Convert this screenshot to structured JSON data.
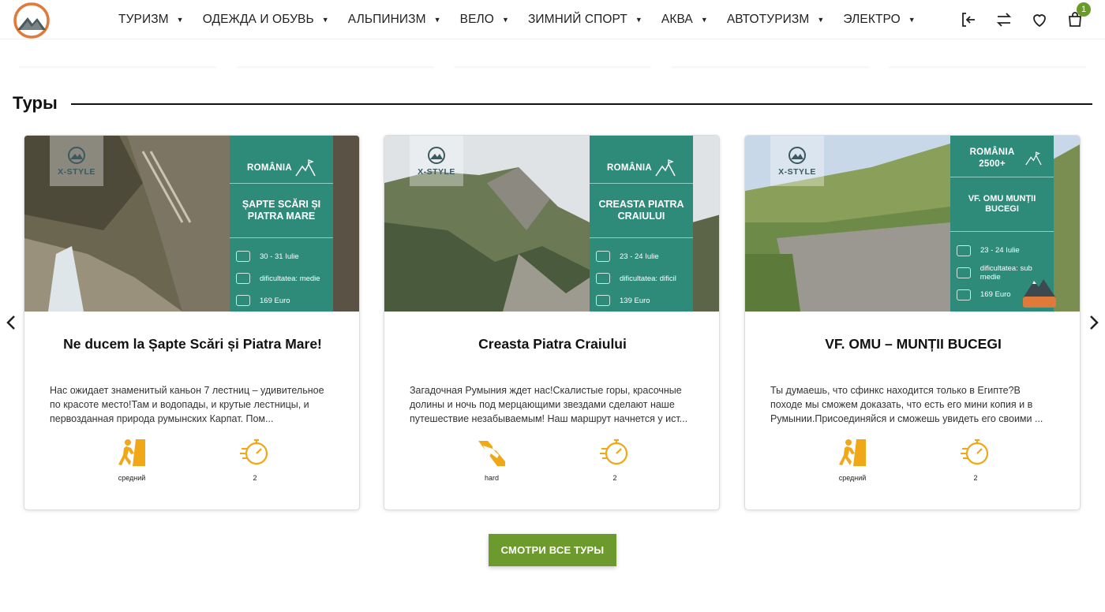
{
  "nav": {
    "items": [
      {
        "label": "ТУРИЗМ"
      },
      {
        "label": "ОДЕЖДА И ОБУВЬ"
      },
      {
        "label": "АЛЬПИНИЗМ"
      },
      {
        "label": "ВЕЛО"
      },
      {
        "label": "ЗИМНИЙ СПОРТ"
      },
      {
        "label": "АКВА"
      },
      {
        "label": "АВТОТУРИЗМ"
      },
      {
        "label": "ЭЛЕКТРО"
      }
    ]
  },
  "header": {
    "cart_count": "1"
  },
  "section": {
    "title": "Туры"
  },
  "tours": [
    {
      "image": {
        "country": "ROMÂNIA",
        "title": "ȘAPTE SCĂRI ȘI PIATRA MARE",
        "dates": "30 - 31 Iulie",
        "difficulty": "dificultatea: medie",
        "price": "169 Euro"
      },
      "title": "Ne ducem la Șapte Scări și Piatra Mare!",
      "description": "Нас ожидает знаменитый каньон 7 лестниц – удивительное по красоте место!Там и водопады, и крутые лестницы, и первозданная природа румынских Карпат. Пом...",
      "difficulty": "средний",
      "duration": "2"
    },
    {
      "image": {
        "country": "ROMÂNIA",
        "title": "CREASTA PIATRA CRAIULUI",
        "dates": "23 - 24 Iulie",
        "difficulty": "dificultatea: dificil",
        "price": "139 Euro"
      },
      "title": "Creasta Piatra Craiului",
      "description": "Загадочная Румыния ждет нас!Скалистые горы, красочные долины и ночь под мерцающими звездами сделают наше путешествие незабываемым! Наш маршрут начнется у ист...",
      "difficulty": "hard",
      "duration": "2"
    },
    {
      "image": {
        "country": "ROMÂNIA 2500+",
        "title": "VF. OMU MUNȚII BUCEGI",
        "dates": "23 - 24 Iulie",
        "difficulty": "dificultatea: sub medie",
        "price": "169 Euro"
      },
      "title": "VF. OMU – MUNȚII BUCEGI",
      "description": "Ты думаешь, что сфинкс находится только в Египте?В походе мы сможем доказать, что есть его мини копия и в Румынии.Присоединяйся и сможешь увидеть его своими ...",
      "difficulty": "средний",
      "duration": "2"
    }
  ],
  "cta": {
    "label": "СМОТРИ ВСЕ ТУРЫ"
  },
  "brand_mark": "X-STYLE",
  "colors": {
    "teal": "#2e8b7a",
    "green": "#6d9a2c",
    "orange": "#e07a3a",
    "icon_gold": "#f0a818"
  },
  "icons": [
    "logo-icon",
    "login-icon",
    "compare-icon",
    "wishlist-icon",
    "cart-icon",
    "chevron-left-icon",
    "chevron-right-icon",
    "hiker-icon",
    "climber-icon",
    "stopwatch-icon"
  ]
}
